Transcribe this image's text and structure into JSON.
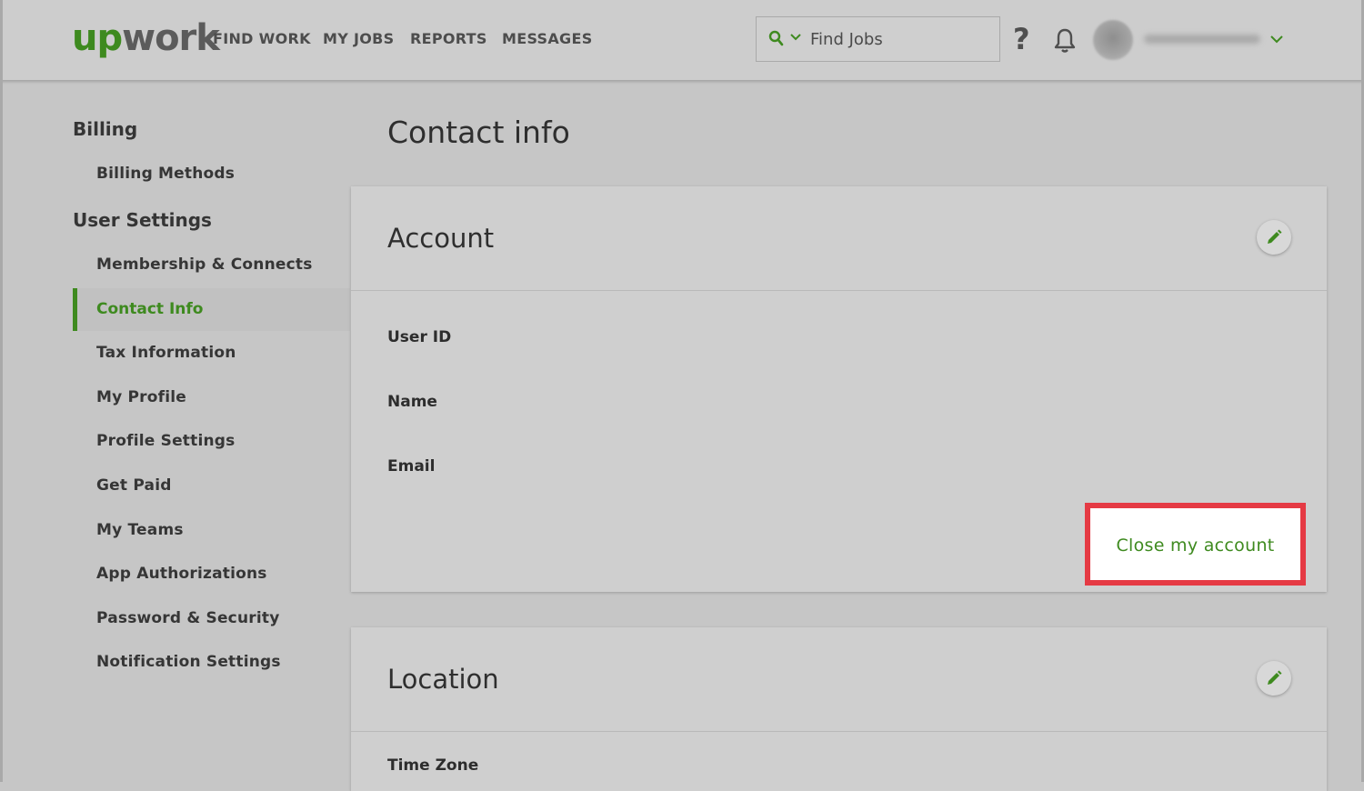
{
  "header": {
    "logo_prefix": "up",
    "logo_suffix": "work",
    "nav": [
      "FIND WORK",
      "MY JOBS",
      "REPORTS",
      "MESSAGES"
    ],
    "search_placeholder": "Find Jobs",
    "help_label": "?",
    "accent_color": "#3e8a1f"
  },
  "sidebar": {
    "billing_heading": "Billing",
    "billing_items": [
      "Billing Methods"
    ],
    "user_settings_heading": "User Settings",
    "items": [
      "Membership & Connects",
      "Contact Info",
      "Tax Information",
      "My Profile",
      "Profile Settings",
      "Get Paid",
      "My Teams",
      "App Authorizations",
      "Password & Security",
      "Notification Settings"
    ],
    "active_item": "Contact Info"
  },
  "main": {
    "title": "Contact info",
    "account": {
      "title": "Account",
      "fields": [
        "User ID",
        "Name",
        "Email"
      ],
      "close_button": "Close my account",
      "highlight_color": "#e53a44"
    },
    "location": {
      "title": "Location",
      "fields": [
        "Time Zone"
      ]
    }
  }
}
